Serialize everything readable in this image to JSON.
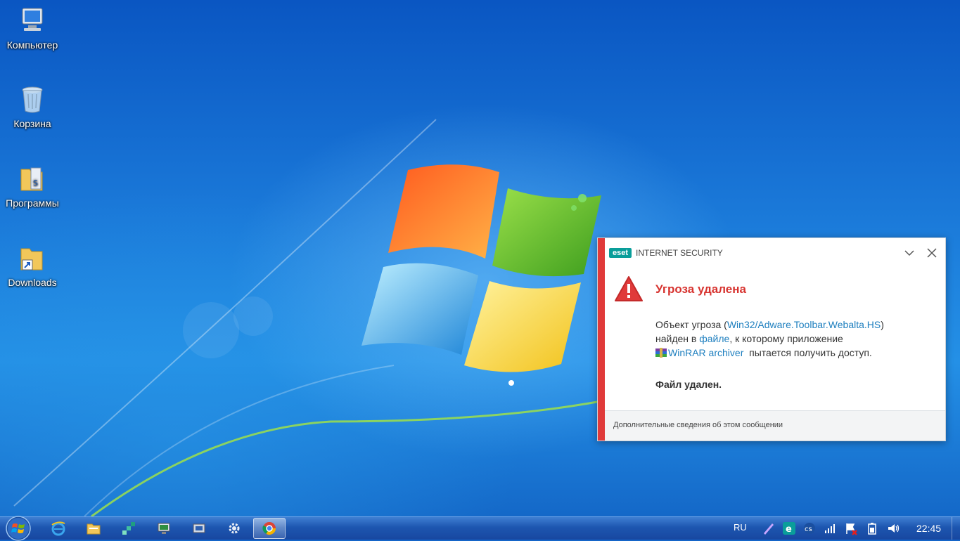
{
  "desktop": {
    "icons": [
      {
        "label": "Компьютер"
      },
      {
        "label": "Корзина"
      },
      {
        "label": "Программы"
      },
      {
        "label": "Downloads"
      }
    ]
  },
  "eset": {
    "logo": "eset",
    "product": "INTERNET SECURITY",
    "title": "Угроза удалена",
    "line1_prefix": "Объект угроза (",
    "threat_name": "Win32/Adware.Toolbar.Webalta.HS",
    "line1_suffix": ")",
    "line2_prefix": "найден в ",
    "file_link": "файле",
    "line2_suffix": ", к которому приложение",
    "app_name": "WinRAR archiver",
    "line3_suffix": "  пытается получить доступ.",
    "result": "Файл удален.",
    "more_info": "Дополнительные сведения об этом сообщении",
    "accent_color": "#e03a3a",
    "link_color": "#1e7fbf"
  },
  "taskbar": {
    "apps": [
      "internet-explorer-icon",
      "file-explorer-icon",
      "network-app-icon",
      "monitor-app-icon",
      "device-app-icon",
      "settings-gear-icon",
      "chrome-icon"
    ],
    "language": "RU",
    "clock": "22:45"
  }
}
